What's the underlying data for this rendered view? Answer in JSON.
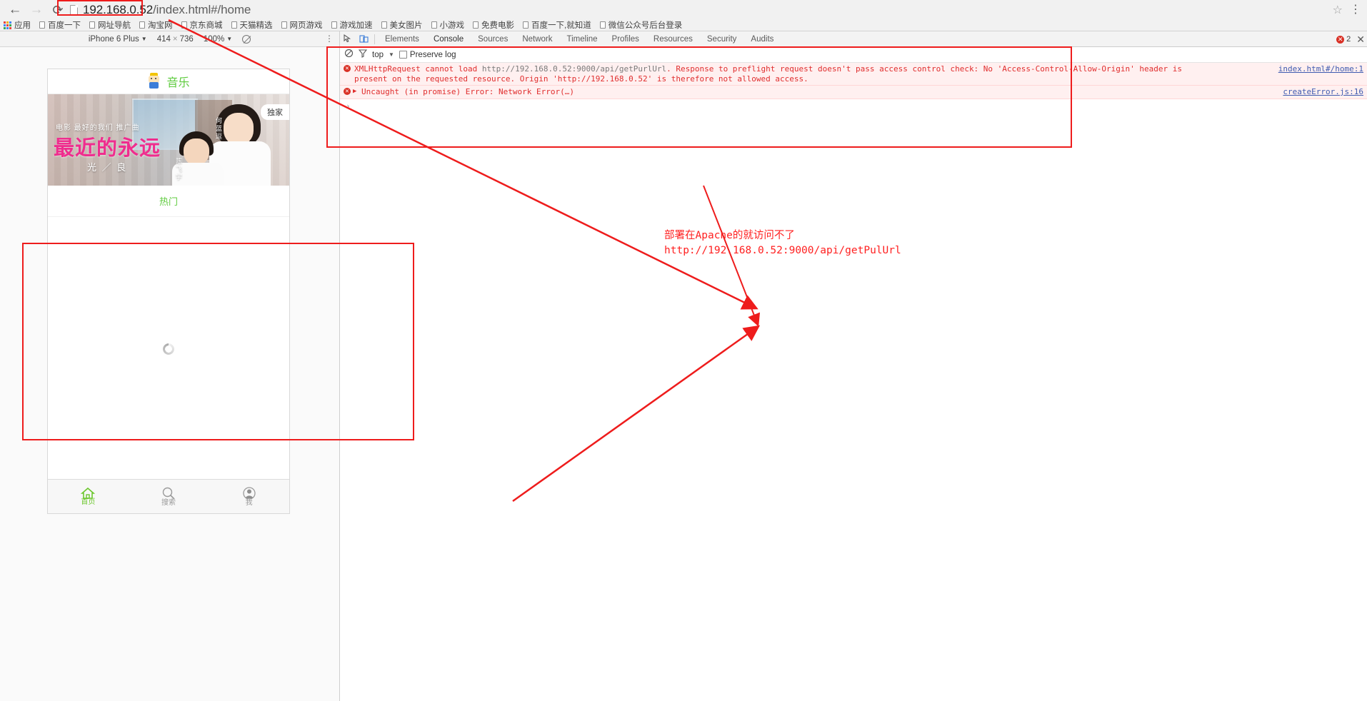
{
  "browser": {
    "back_icon": "back-arrow-icon",
    "forward_icon": "forward-arrow-icon",
    "reload_icon": "reload-icon",
    "url_host": "192.168.0.52",
    "url_path": "/index.html#/home",
    "star_glyph": "☆",
    "menu_glyph": "⋮",
    "bookmarks": [
      {
        "label": "应用",
        "icon": "apps-grid-icon"
      },
      {
        "label": "百度一下",
        "icon": "page-icon"
      },
      {
        "label": "网址导航",
        "icon": "page-icon"
      },
      {
        "label": "淘宝网",
        "icon": "page-icon"
      },
      {
        "label": "京东商城",
        "icon": "page-icon"
      },
      {
        "label": "天猫精选",
        "icon": "page-icon"
      },
      {
        "label": "网页游戏",
        "icon": "page-icon"
      },
      {
        "label": "游戏加速",
        "icon": "page-icon"
      },
      {
        "label": "美女图片",
        "icon": "page-icon"
      },
      {
        "label": "小游戏",
        "icon": "page-icon"
      },
      {
        "label": "免费电影",
        "icon": "page-icon"
      },
      {
        "label": "百度一下,就知道",
        "icon": "page-icon"
      },
      {
        "label": "微信公众号后台登录",
        "icon": "page-icon"
      }
    ]
  },
  "device_toolbar": {
    "device_name": "iPhone 6 Plus",
    "width": "414",
    "times": "×",
    "height": "736",
    "zoom": "100%",
    "caret": "▼",
    "kebab": "⋮",
    "rotate_icon": "rotate-screen-icon"
  },
  "devtools": {
    "inspect_icon": "inspect-element-icon",
    "device_icon": "toggle-device-toolbar-icon",
    "tabs": [
      {
        "label": "Elements",
        "active": false
      },
      {
        "label": "Console",
        "active": true
      },
      {
        "label": "Sources",
        "active": false
      },
      {
        "label": "Network",
        "active": false
      },
      {
        "label": "Timeline",
        "active": false
      },
      {
        "label": "Profiles",
        "active": false
      },
      {
        "label": "Resources",
        "active": false
      },
      {
        "label": "Security",
        "active": false
      },
      {
        "label": "Audits",
        "active": false
      }
    ],
    "error_count": "2",
    "error_badge_glyph": "✕",
    "close_glyph": "✕",
    "console_toolbar": {
      "clear_icon": "clear-console-icon",
      "filter_icon": "filter-icon",
      "context": "top",
      "context_caret": "▼",
      "preserve_log_label": "Preserve log",
      "preserve_log_checked": false
    },
    "messages": [
      {
        "icon": "error-icon",
        "text_line1_a": "XMLHttpRequest cannot load ",
        "text_line1_url": "http://192.168.0.52:9000/api/getPurlUrl",
        "text_line1_b": ". Response to preflight request doesn't pass access control check: No 'Access-Control-Allow-Origin' header is",
        "text_line2": "present on the requested resource. Origin 'http://192.168.0.52' is therefore not allowed access.",
        "link": "index.html#/home:1",
        "expandable": false
      },
      {
        "icon": "error-icon",
        "text": "Uncaught (in promise) Error: Network Error(…)",
        "link": "createError.js:16",
        "expandable": true,
        "arrow": "▶"
      }
    ],
    "prompt_glyph": "›"
  },
  "phone_app": {
    "header": {
      "mascot_icon": "app-mascot-icon",
      "title": "音乐",
      "title_color": "#5ecb3e"
    },
    "banner": {
      "caption_top": "电影 最好的我们 推广曲",
      "song_title": "最近的永远",
      "artist": "光 ／ 良",
      "credit_right": "何蓝逗",
      "credit_left": "陈飞宇",
      "badge": "独家"
    },
    "section_hot": "热门",
    "loading_icon": "loading-spinner-icon",
    "tabbar": [
      {
        "label": "首页",
        "icon": "home-icon",
        "active": true
      },
      {
        "label": "搜索",
        "icon": "search-icon",
        "active": false
      },
      {
        "label": "我",
        "icon": "person-icon",
        "active": false
      }
    ]
  },
  "annotations": {
    "note_line1": "部署在Apache的就访问不了",
    "note_line2": "http://192.168.0.52:9000/api/getPulUrl",
    "color": "#ff2020"
  }
}
